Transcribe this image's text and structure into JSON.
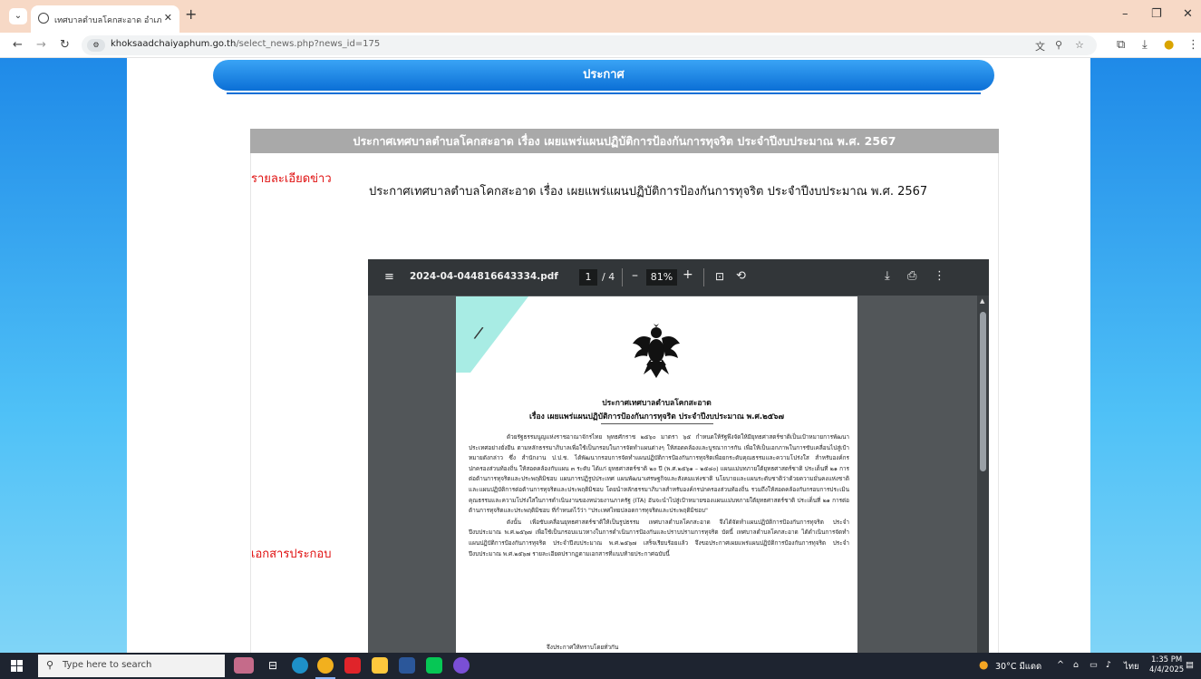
{
  "browser": {
    "tab_title": "เทศบาลตำบลโคกสะอาด อำเภอหนองบัวแดง",
    "tab_close": "✕",
    "new_tab": "+",
    "url_host": "khoksaadchaiyaphum.go.th",
    "url_path": "/select_news.php?news_id=175"
  },
  "page": {
    "banner": "ประกาศ",
    "news_title": "ประกาศเทศบาลตำบลโคกสะอาด เรื่อง เผยแพร่แผนปฏิบัติการป้องกันการทุจริต ประจำปีงบประมาณ พ.ศ. 2567",
    "label_detail": "รายละเอียดข่าว",
    "detail_text": "ประกาศเทศบาลตำบลโคกสะอาด เรื่อง เผยแพร่แผนปฏิบัติการป้องกันการทุจริต ประจำปีงบประมาณ พ.ศ. 2567",
    "label_attach": "เอกสารประกอบ"
  },
  "pdf": {
    "filename": "2024-04-044816643334.pdf",
    "page_current": "1",
    "page_total": "/ 4",
    "zoom": "81%",
    "doc_heading": "ประกาศเทศบาลตำบลโคกสะอาด",
    "doc_subject": "เรื่อง เผยแพร่แผนปฏิบัติการป้องกันการทุจริต ประจำปีงบประมาณ พ.ศ.๒๕๖๗",
    "doc_para1": "ด้วยรัฐธรรมนูญแห่งราชอาณาจักรไทย พุทธศักราช ๒๕๖๐ มาตรา ๖๕ กำหนดให้รัฐพึงจัดให้มียุทธศาสตร์ชาติเป็นเป้าหมายการพัฒนาประเทศอย่างยั่งยืน ตามหลักธรรมาภิบาลเพื่อใช้เป็นกรอบในการจัดทำแผนต่างๆ ให้สอดคล้องและบูรณาการกัน เพื่อให้เป็นเอกภาพในการขับเคลื่อนไปสู่เป้าหมายดังกล่าว ซึ่ง สำนักงาน ป.ป.ช. ได้พัฒนากรอบการจัดทำแผนปฏิบัติการป้องกันการทุจริตเพื่อยกระดับคุณธรรมและความโปร่งใส สำหรับองค์กรปกครองส่วนท้องถิ่น ให้สอดคล้องกับแผน ๓ ระดับ ได้แก่ ยุทธศาสตร์ชาติ ๒๐ ปี (พ.ศ.๒๕๖๑ – ๒๕๘๐) แผนแม่บทภายใต้ยุทธศาสตร์ชาติ ประเด็นที่ ๒๑ การต่อต้านการทุจริตและประพฤติมิชอบ แผนการปฏิรูปประเทศ แผนพัฒนาเศรษฐกิจและสังคมแห่งชาติ นโยบายและแผนระดับชาติว่าด้วยความมั่นคงแห่งชาติ และแผนปฏิบัติการต่อต้านการทุจริตและประพฤติมิชอบ โดยนำหลักธรรมาภิบาลสำหรับองค์กรปกครองส่วนท้องถิ่น รวมถึงให้สอดคล้องกับกรอบการประเมินคุณธรรมและความโปร่งใสในการดำเนินงานของหน่วยงานภาครัฐ (ITA) อันจะนำไปสู่เป้าหมายของแผนแม่บทภายใต้ยุทธศาสตร์ชาติ ประเด็นที่ ๒๑ การต่อต้านการทุจริตและประพฤติมิชอบ ที่กำหนดไว้ว่า \"ประเทศไทยปลอดการทุจริตและประพฤติมิชอบ\"",
    "doc_para2": "ดังนั้น เพื่อขับเคลื่อนยุทธศาสตร์ชาติให้เป็นรูปธรรม เทศบาลตำบลโคกสะอาด จึงได้จัดทำแผนปฏิบัติการป้องกันการทุจริต ประจำปีงบประมาณ พ.ศ.๒๕๖๗ เพื่อใช้เป็นกรอบแนวทางในการดำเนินการป้องกันและปราบปรามการทุจริต บัดนี้ เทศบาลตำบลโคกสะอาด ได้ดำเนินการจัดทำแผนปฏิบัติการป้องกันการทุจริต ประจำปีงบประมาณ พ.ศ.๒๕๖๗ เสร็จเรียบร้อยแล้ว จึงขอประกาศเผยแพร่แผนปฏิบัติการป้องกันการทุจริต ประจำปีงบประมาณ พ.ศ.๒๕๖๗ รายละเอียดปรากฏตามเอกสารที่แนบท้ายประกาศฉบับนี้",
    "doc_closing": "จึงประกาศให้ทราบโดยทั่วกัน"
  },
  "taskbar": {
    "search_placeholder": "Type here to search",
    "weather": "30°C มีแดด",
    "lang": "ไทย",
    "time": "1:35 PM",
    "date": "4/4/2025"
  },
  "colors": {
    "banner": "#0b6fd6",
    "title_bar": "#a9a9a9",
    "label_red": "#e01010",
    "side_blue": "#1f8ae8"
  }
}
